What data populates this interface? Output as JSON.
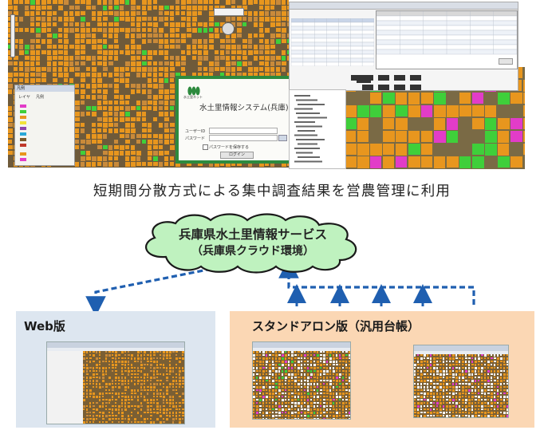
{
  "headline": "短期間分散方式による集中調査結果を営農管理に利用",
  "cloud": {
    "title": "兵庫県水土里情報サービス",
    "subtitle": "（兵庫県クラウド環境）"
  },
  "web_version": {
    "label": "Web版"
  },
  "standalone_version": {
    "label": "スタンドアロン版（汎用台帳）"
  },
  "login_dialog": {
    "system_title": "水土里情報システム(兵庫)",
    "logo_caption": "水土里ネット",
    "user_label": "ユーザーID",
    "password_label": "パスワード",
    "remember_label": "パスワードを保存する",
    "login_button": "ログイン"
  },
  "legend_panel": {
    "title": "凡例",
    "tabs": [
      "レイヤ",
      "凡例"
    ]
  },
  "colors": {
    "parcel_orange": "#e8961e",
    "parcel_green": "#3fcf3a",
    "parcel_magenta": "#e23cc8",
    "cloud_fill": "#bff2bf",
    "arrow_blue": "#1f5fb0",
    "web_box": "#dde6f0",
    "standalone_box": "#fbd7b4"
  }
}
